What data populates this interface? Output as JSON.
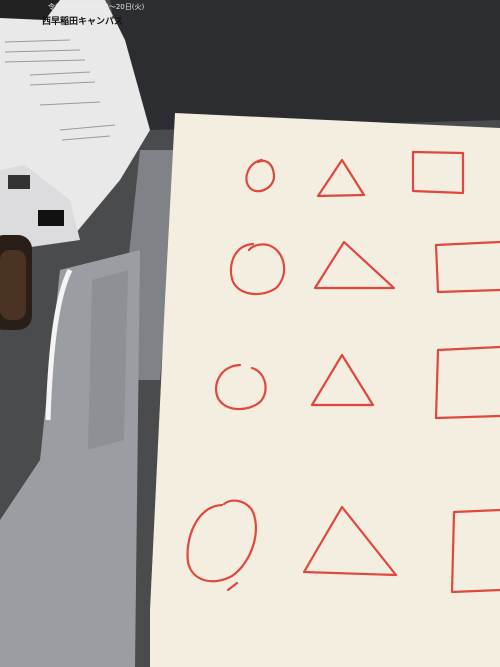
{
  "scene": {
    "description_label": "",
    "flyer": {
      "date_line": "令和年3月17日(土)〜20日(火)",
      "campus_line": "西早稲田キャンパス"
    }
  },
  "colors": {
    "desk": "#4a4b4d",
    "laptop_body": "#9a9ea3",
    "laptop_dark": "#2c2d31",
    "paper": "#f3eee0",
    "ink_red": "#e0483e",
    "flyer_paper": "#e9e9ea"
  },
  "drawing": {
    "rows": [
      {
        "shapes": [
          "circle-icon",
          "triangle-icon",
          "square-icon"
        ]
      },
      {
        "shapes": [
          "circle-icon",
          "triangle-icon",
          "square-icon"
        ]
      },
      {
        "shapes": [
          "circle-icon",
          "triangle-icon",
          "square-icon"
        ]
      },
      {
        "shapes": [
          "circle-icon",
          "triangle-icon",
          "square-icon"
        ]
      }
    ]
  }
}
